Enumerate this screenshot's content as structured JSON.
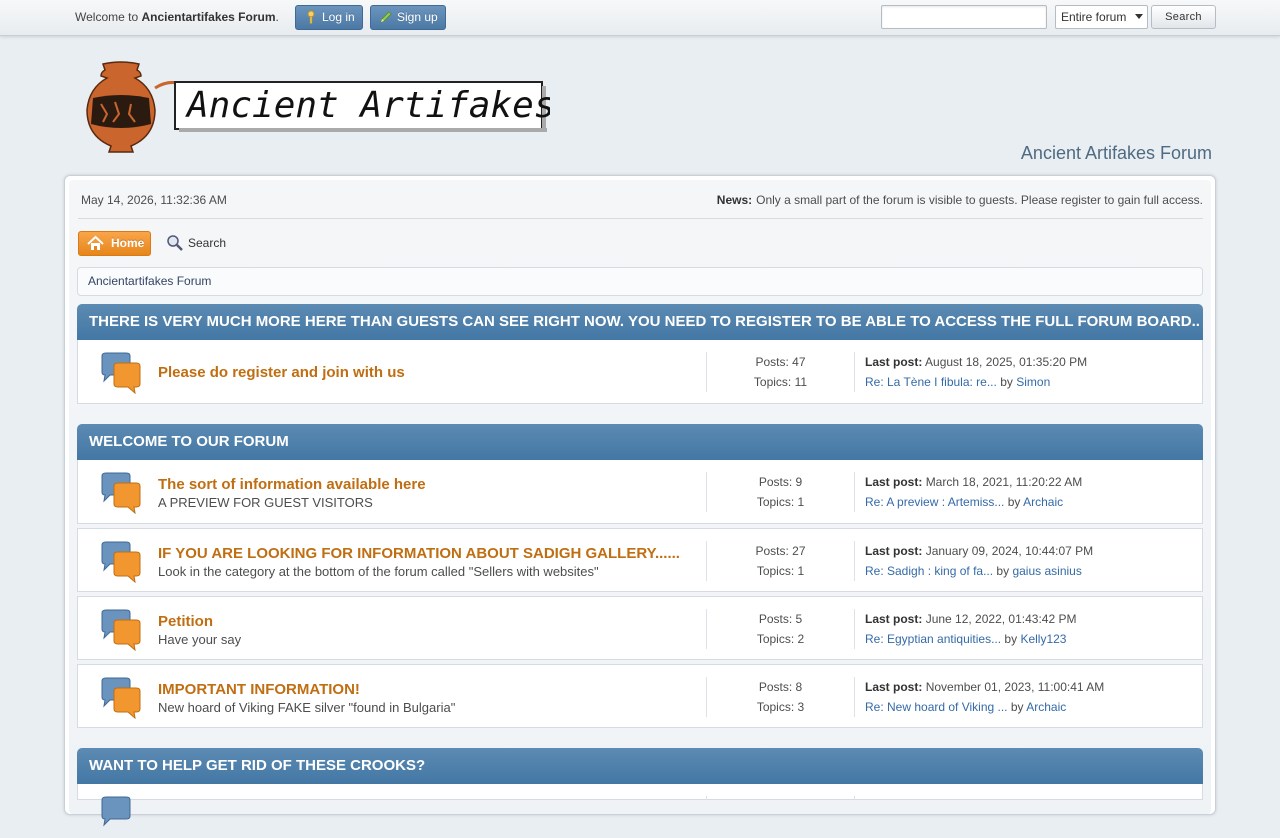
{
  "topbar": {
    "welcome_prefix": "Welcome to ",
    "welcome_name": "Ancientartifakes Forum",
    "welcome_suffix": ".",
    "login_label": "Log in",
    "signup_label": "Sign up",
    "search_placeholder": "",
    "search_scope": "Entire forum",
    "search_button": "Search"
  },
  "header": {
    "logo_text": "Ancient Artifakes",
    "forum_name": "Ancient Artifakes Forum"
  },
  "infobar": {
    "date": "May 14, 2026, 11:32:36 AM",
    "news_label": "News:",
    "news_text": "Only a small part of the forum is visible to guests. Please register to gain full access."
  },
  "nav": {
    "home_label": "Home",
    "search_label": "Search"
  },
  "breadcrumb": {
    "label": "Ancientartifakes Forum"
  },
  "categories": [
    {
      "title": "THERE IS VERY MUCH MORE HERE THAN GUESTS CAN SEE RIGHT NOW. YOU NEED TO REGISTER TO BE ABLE TO ACCESS THE FULL FORUM BOARD..",
      "boards": [
        {
          "title": "Please do register and join with us",
          "desc": "",
          "posts": "Posts: 47",
          "topics": "Topics: 11",
          "last_label": "Last post:",
          "last_date": "August 18, 2025, 01:35:20 PM",
          "last_topic": "Re: La Tène I fibula: re...",
          "by": "by",
          "last_user": "Simon"
        }
      ]
    },
    {
      "title": "WELCOME TO OUR FORUM",
      "boards": [
        {
          "title": "The sort of information available here",
          "desc": "A PREVIEW FOR GUEST VISITORS",
          "posts": "Posts: 9",
          "topics": "Topics: 1",
          "last_label": "Last post:",
          "last_date": "March 18, 2021, 11:20:22 AM",
          "last_topic": "Re: A preview : Artemiss...",
          "by": "by",
          "last_user": "Archaic"
        },
        {
          "title": "IF YOU ARE LOOKING FOR INFORMATION ABOUT SADIGH GALLERY......",
          "desc": "Look in the category at the bottom of the forum called \"Sellers with websites\"",
          "posts": "Posts: 27",
          "topics": "Topics: 1",
          "last_label": "Last post:",
          "last_date": "January 09, 2024, 10:44:07 PM",
          "last_topic": "Re: Sadigh : king of fa...",
          "by": "by",
          "last_user": "gaius asinius"
        },
        {
          "title": "Petition",
          "desc": "Have your say",
          "posts": "Posts: 5",
          "topics": "Topics: 2",
          "last_label": "Last post:",
          "last_date": "June 12, 2022, 01:43:42 PM",
          "last_topic": "Re: Egyptian antiquities...",
          "by": "by",
          "last_user": "Kelly123"
        },
        {
          "title": "IMPORTANT INFORMATION!",
          "desc": "New hoard of Viking FAKE silver \"found in Bulgaria\"",
          "posts": "Posts: 8",
          "topics": "Topics: 3",
          "last_label": "Last post:",
          "last_date": "November 01, 2023, 11:00:41 AM",
          "last_topic": "Re: New hoard of Viking ...",
          "by": "by",
          "last_user": "Archaic"
        }
      ]
    },
    {
      "title": "WANT TO HELP GET RID OF THESE CROOKS?",
      "boards": []
    }
  ],
  "colors": {
    "accent_orange": "#e6861c",
    "header_blue": "#4377a4",
    "link_blue": "#346aa8",
    "title_orange": "#c06e12"
  }
}
